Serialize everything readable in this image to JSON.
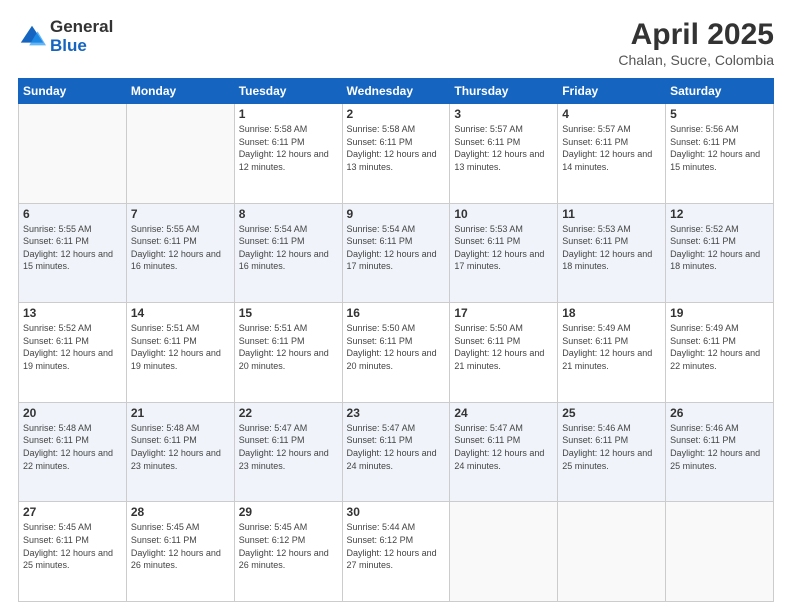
{
  "logo": {
    "general": "General",
    "blue": "Blue"
  },
  "title": "April 2025",
  "location": "Chalan, Sucre, Colombia",
  "days_of_week": [
    "Sunday",
    "Monday",
    "Tuesday",
    "Wednesday",
    "Thursday",
    "Friday",
    "Saturday"
  ],
  "weeks": [
    [
      {
        "day": "",
        "info": ""
      },
      {
        "day": "",
        "info": ""
      },
      {
        "day": "1",
        "info": "Sunrise: 5:58 AM\nSunset: 6:11 PM\nDaylight: 12 hours\nand 12 minutes."
      },
      {
        "day": "2",
        "info": "Sunrise: 5:58 AM\nSunset: 6:11 PM\nDaylight: 12 hours\nand 13 minutes."
      },
      {
        "day": "3",
        "info": "Sunrise: 5:57 AM\nSunset: 6:11 PM\nDaylight: 12 hours\nand 13 minutes."
      },
      {
        "day": "4",
        "info": "Sunrise: 5:57 AM\nSunset: 6:11 PM\nDaylight: 12 hours\nand 14 minutes."
      },
      {
        "day": "5",
        "info": "Sunrise: 5:56 AM\nSunset: 6:11 PM\nDaylight: 12 hours\nand 15 minutes."
      }
    ],
    [
      {
        "day": "6",
        "info": "Sunrise: 5:55 AM\nSunset: 6:11 PM\nDaylight: 12 hours\nand 15 minutes."
      },
      {
        "day": "7",
        "info": "Sunrise: 5:55 AM\nSunset: 6:11 PM\nDaylight: 12 hours\nand 16 minutes."
      },
      {
        "day": "8",
        "info": "Sunrise: 5:54 AM\nSunset: 6:11 PM\nDaylight: 12 hours\nand 16 minutes."
      },
      {
        "day": "9",
        "info": "Sunrise: 5:54 AM\nSunset: 6:11 PM\nDaylight: 12 hours\nand 17 minutes."
      },
      {
        "day": "10",
        "info": "Sunrise: 5:53 AM\nSunset: 6:11 PM\nDaylight: 12 hours\nand 17 minutes."
      },
      {
        "day": "11",
        "info": "Sunrise: 5:53 AM\nSunset: 6:11 PM\nDaylight: 12 hours\nand 18 minutes."
      },
      {
        "day": "12",
        "info": "Sunrise: 5:52 AM\nSunset: 6:11 PM\nDaylight: 12 hours\nand 18 minutes."
      }
    ],
    [
      {
        "day": "13",
        "info": "Sunrise: 5:52 AM\nSunset: 6:11 PM\nDaylight: 12 hours\nand 19 minutes."
      },
      {
        "day": "14",
        "info": "Sunrise: 5:51 AM\nSunset: 6:11 PM\nDaylight: 12 hours\nand 19 minutes."
      },
      {
        "day": "15",
        "info": "Sunrise: 5:51 AM\nSunset: 6:11 PM\nDaylight: 12 hours\nand 20 minutes."
      },
      {
        "day": "16",
        "info": "Sunrise: 5:50 AM\nSunset: 6:11 PM\nDaylight: 12 hours\nand 20 minutes."
      },
      {
        "day": "17",
        "info": "Sunrise: 5:50 AM\nSunset: 6:11 PM\nDaylight: 12 hours\nand 21 minutes."
      },
      {
        "day": "18",
        "info": "Sunrise: 5:49 AM\nSunset: 6:11 PM\nDaylight: 12 hours\nand 21 minutes."
      },
      {
        "day": "19",
        "info": "Sunrise: 5:49 AM\nSunset: 6:11 PM\nDaylight: 12 hours\nand 22 minutes."
      }
    ],
    [
      {
        "day": "20",
        "info": "Sunrise: 5:48 AM\nSunset: 6:11 PM\nDaylight: 12 hours\nand 22 minutes."
      },
      {
        "day": "21",
        "info": "Sunrise: 5:48 AM\nSunset: 6:11 PM\nDaylight: 12 hours\nand 23 minutes."
      },
      {
        "day": "22",
        "info": "Sunrise: 5:47 AM\nSunset: 6:11 PM\nDaylight: 12 hours\nand 23 minutes."
      },
      {
        "day": "23",
        "info": "Sunrise: 5:47 AM\nSunset: 6:11 PM\nDaylight: 12 hours\nand 24 minutes."
      },
      {
        "day": "24",
        "info": "Sunrise: 5:47 AM\nSunset: 6:11 PM\nDaylight: 12 hours\nand 24 minutes."
      },
      {
        "day": "25",
        "info": "Sunrise: 5:46 AM\nSunset: 6:11 PM\nDaylight: 12 hours\nand 25 minutes."
      },
      {
        "day": "26",
        "info": "Sunrise: 5:46 AM\nSunset: 6:11 PM\nDaylight: 12 hours\nand 25 minutes."
      }
    ],
    [
      {
        "day": "27",
        "info": "Sunrise: 5:45 AM\nSunset: 6:11 PM\nDaylight: 12 hours\nand 25 minutes."
      },
      {
        "day": "28",
        "info": "Sunrise: 5:45 AM\nSunset: 6:11 PM\nDaylight: 12 hours\nand 26 minutes."
      },
      {
        "day": "29",
        "info": "Sunrise: 5:45 AM\nSunset: 6:12 PM\nDaylight: 12 hours\nand 26 minutes."
      },
      {
        "day": "30",
        "info": "Sunrise: 5:44 AM\nSunset: 6:12 PM\nDaylight: 12 hours\nand 27 minutes."
      },
      {
        "day": "",
        "info": ""
      },
      {
        "day": "",
        "info": ""
      },
      {
        "day": "",
        "info": ""
      }
    ]
  ]
}
